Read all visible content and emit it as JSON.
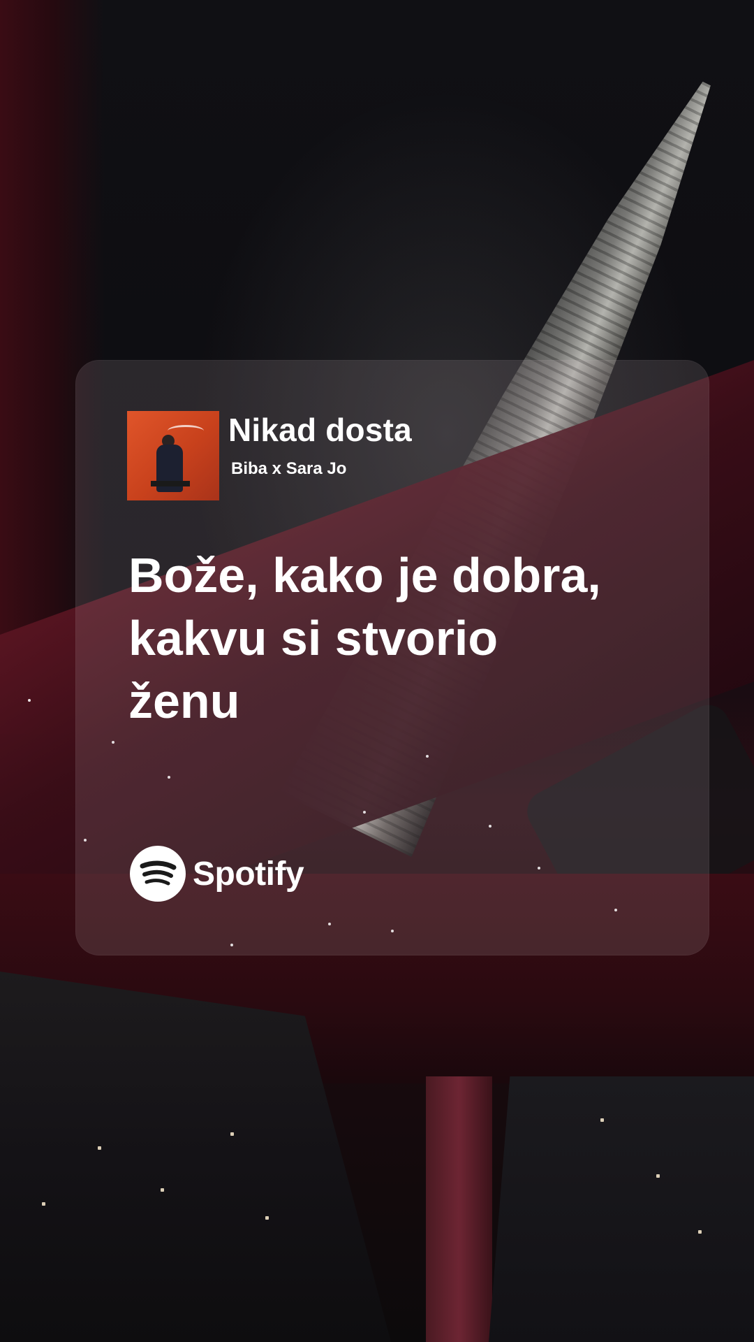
{
  "story": {
    "track": {
      "title": "Nikad dosta",
      "artist": "Biba x Sara Jo",
      "cover_icon": "album-cover"
    },
    "lyrics": [
      "Bože, kako je dobra,",
      "kakvu si stvorio",
      "ženu"
    ],
    "brand": {
      "name": "Spotify",
      "icon": "spotify-logo-icon"
    }
  },
  "colors": {
    "card_background": "rgba(190,170,175,0.17)",
    "text": "#ffffff",
    "cover_orange": "#e0552a",
    "background_dark": "#0b0a0d",
    "interior_red": "#5a1522"
  }
}
